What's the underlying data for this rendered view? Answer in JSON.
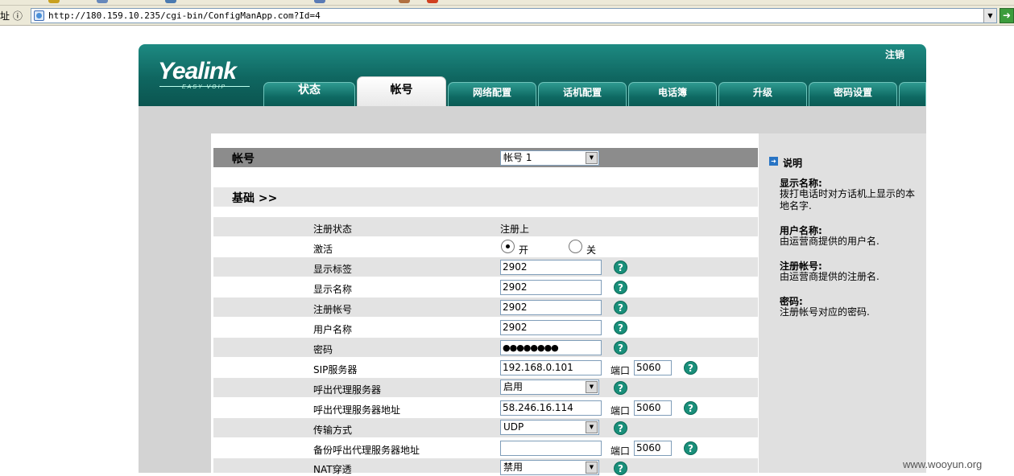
{
  "browser": {
    "address_label": "址 ⓘ",
    "url": "http://180.159.10.235/cgi-bin/ConfigManApp.com?Id=4",
    "go_icon": "arrow-right-icon"
  },
  "header": {
    "logo": "Yealink",
    "logo_sub": "EASY VOIP",
    "logout": "注销",
    "tabs": [
      "状态",
      "帐号",
      "网络配置",
      "话机配置",
      "电话簿",
      "升级",
      "密码设置"
    ],
    "active_tab": "帐号"
  },
  "account_section": {
    "title": "帐号",
    "account_select": "帐号 1"
  },
  "basic_section": {
    "title": "基础 >>"
  },
  "form": {
    "reg_status": {
      "label": "注册状态",
      "value": "注册上"
    },
    "activate": {
      "label": "激活",
      "on": "开",
      "off": "关",
      "selected": "开"
    },
    "display_label": {
      "label": "显示标签",
      "value": "2902"
    },
    "display_name": {
      "label": "显示名称",
      "value": "2902"
    },
    "register_name": {
      "label": "注册帐号",
      "value": "2902"
    },
    "user_name": {
      "label": "用户名称",
      "value": "2902"
    },
    "password": {
      "label": "密码",
      "value": "●●●●●●●●"
    },
    "sip_server": {
      "label": "SIP服务器",
      "value": "192.168.0.101",
      "port_label": "端口",
      "port": "5060"
    },
    "outbound_proxy": {
      "label": "呼出代理服务器",
      "value": "启用"
    },
    "outbound_proxy_addr": {
      "label": "呼出代理服务器地址",
      "value": "58.246.16.114",
      "port_label": "端口",
      "port": "5060"
    },
    "transport": {
      "label": "传输方式",
      "value": "UDP"
    },
    "backup_proxy_addr": {
      "label": "备份呼出代理服务器地址",
      "value": "",
      "port_label": "端口",
      "port": "5060"
    },
    "nat": {
      "label": "NAT穿透",
      "value": "禁用"
    }
  },
  "help_panel": {
    "title": "说明",
    "items": [
      {
        "title": "显示名称:",
        "body": "拨打电话时对方话机上显示的本地名字."
      },
      {
        "title": "用户名称:",
        "body": "由运营商提供的用户名."
      },
      {
        "title": "注册帐号:",
        "body": "由运营商提供的注册名."
      },
      {
        "title": "密码:",
        "body": "注册帐号对应的密码."
      }
    ]
  },
  "watermark": "www.wooyun.org",
  "colors": {
    "banner": "#0f6660",
    "help_icon": "#198f7a",
    "row_alt": "#e3e3e3"
  }
}
